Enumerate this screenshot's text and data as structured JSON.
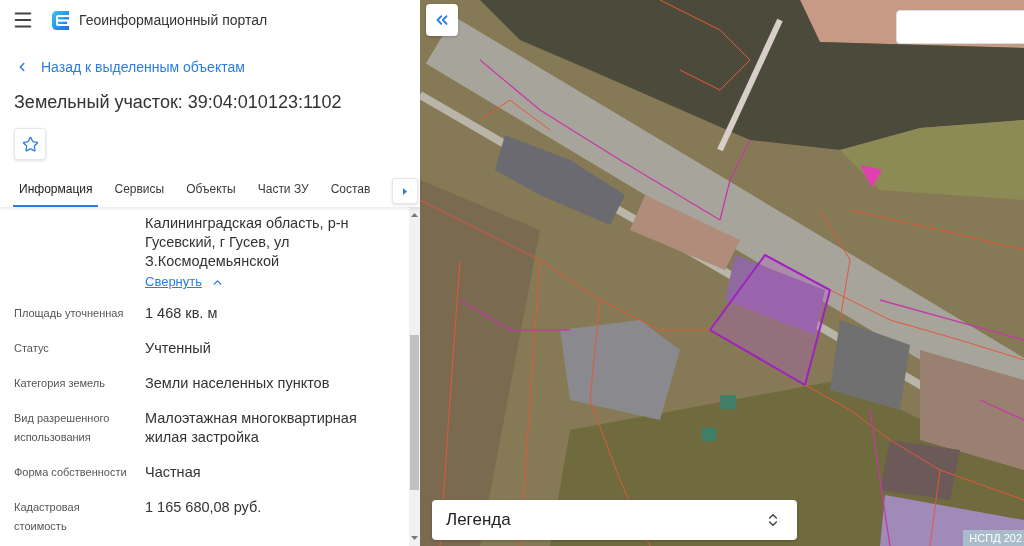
{
  "header": {
    "title": "Геоинформационный портал"
  },
  "back_link": {
    "label": "Назад к выделенным объектам"
  },
  "object": {
    "title": "Земельный участок: 39:04:010123:1102",
    "favorite": {
      "on": false
    }
  },
  "tabs": [
    {
      "label": "Информация",
      "selected": true
    },
    {
      "label": "Сервисы",
      "selected": false
    },
    {
      "label": "Объекты",
      "selected": false
    },
    {
      "label": "Части ЗУ",
      "selected": false
    },
    {
      "label": "Состав",
      "selected": false
    }
  ],
  "address": {
    "value": "Калининградская область, р-н Гусевский, г Гусев, ул З.Космодемьянской",
    "collapse_link": "Свернуть"
  },
  "properties": [
    {
      "label": "Площадь уточненная",
      "value": "1 468 кв. м"
    },
    {
      "label": "Статус",
      "value": "Учтенный"
    },
    {
      "label": "Категория земель",
      "value": "Земли населенных пунктов"
    },
    {
      "label": "Вид разрешенного использования",
      "value": "Малоэтажная многоквартирная жилая застройка"
    },
    {
      "label": "Форма собственности",
      "value": "Частная"
    },
    {
      "label": "Кадастровая стоимость",
      "value": "1 165 680,08 руб."
    }
  ],
  "map": {
    "legend": {
      "label": "Легенда"
    },
    "attribution": "НСПД 202"
  }
}
